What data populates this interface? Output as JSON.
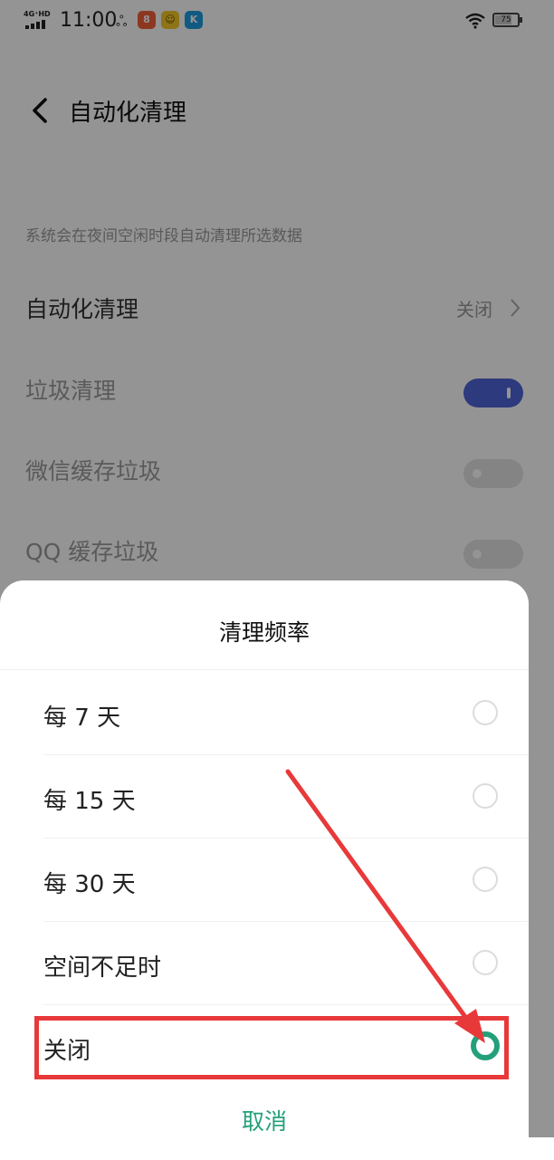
{
  "status_bar": {
    "network": "4G⁺HD",
    "time": "11:00",
    "battery": "75",
    "battery_level": 0.75,
    "app_icons": [
      {
        "name": "weibo-icon",
        "glyph": "ஃ"
      },
      {
        "name": "app-icon-red",
        "color": "#f2603a",
        "glyph": "8"
      },
      {
        "name": "app-icon-yellow",
        "color": "#f5c928",
        "glyph": "☺"
      },
      {
        "name": "app-icon-blue",
        "color": "#1e9ce0",
        "glyph": "K"
      }
    ]
  },
  "header": {
    "title": "自动化清理"
  },
  "settings": {
    "description": "系统会在夜间空闲时段自动清理所选数据",
    "auto_clean": {
      "label": "自动化清理",
      "value": "关闭"
    },
    "items": [
      {
        "label": "垃圾清理",
        "enabled": true
      },
      {
        "label": "微信缓存垃圾",
        "enabled": false
      },
      {
        "label": "QQ 缓存垃圾",
        "enabled": false
      }
    ]
  },
  "dialog": {
    "title": "清理频率",
    "options": [
      {
        "label": "每 7 天",
        "selected": false
      },
      {
        "label": "每 15 天",
        "selected": false
      },
      {
        "label": "每 30 天",
        "selected": false
      },
      {
        "label": "空间不足时",
        "selected": false
      },
      {
        "label": "关闭",
        "selected": true
      }
    ],
    "cancel_label": "取消"
  },
  "colors": {
    "accent": "#23a07a",
    "toggle_on": "#4f64d8",
    "annotation": "#e8393a"
  }
}
